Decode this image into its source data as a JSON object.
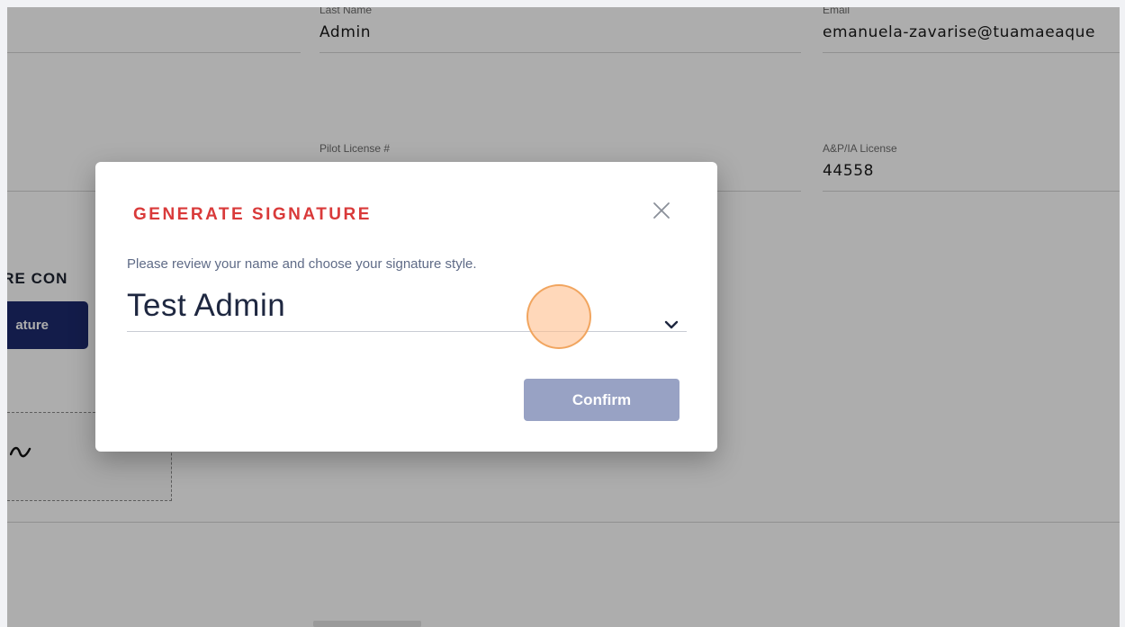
{
  "form": {
    "last_name_label": "Last Name",
    "last_name_value": "Admin",
    "email_label": "Email",
    "email_value": "emanuela-zavarise@tuamaeaque",
    "pilot_license_label": "Pilot License #",
    "pilot_license_value": "",
    "ap_license_label": "A&P/IA License",
    "ap_license_value": "44558",
    "section_title": "URE CON",
    "signature_button_label": "ature"
  },
  "modal": {
    "title": "GENERATE SIGNATURE",
    "description": "Please review your name and choose your signature style.",
    "name_value": "Test Admin",
    "confirm_label": "Confirm",
    "close_icon": "close-icon",
    "dropdown_icon": "chevron-down-icon"
  },
  "colors": {
    "title_red": "#d93a3a",
    "primary_navy": "#1c2a6e",
    "confirm_disabled": "#98a2c4",
    "click_indicator": "#f0a055"
  }
}
